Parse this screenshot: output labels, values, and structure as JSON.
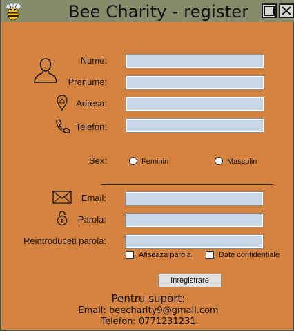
{
  "window": {
    "title": "Bee Charity - register",
    "minimize_label": "minimize",
    "close_label": "close"
  },
  "form": {
    "nume_label": "Nume:",
    "prenume_label": "Prenume:",
    "adresa_label": "Adresa:",
    "telefon_label": "Telefon:",
    "nume_value": "",
    "prenume_value": "",
    "adresa_value": "",
    "telefon_value": "",
    "sex_label": "Sex:",
    "sex_options": [
      "Feminin",
      "Masculin"
    ],
    "email_label": "Email:",
    "parola_label": "Parola:",
    "reintroduceti_label": "Reintroduceti parola:",
    "email_value": "",
    "parola_value": "",
    "reintroduceti_value": "",
    "afiseaza_label": "Afiseaza parola",
    "confidentiale_label": "Date confidentiale",
    "submit_label": "Inregistrare"
  },
  "support": {
    "heading": "Pentru suport:",
    "email": "Email: beecharity9@gmail.com",
    "phone": "Telefon: 0771231231"
  },
  "colors": {
    "background": "#d4823f",
    "titlebar": "#858c6b",
    "field": "#c8d7e6"
  },
  "icons": [
    "bee-icon",
    "user-icon",
    "location-pin-icon",
    "phone-icon",
    "envelope-icon",
    "padlock-icon"
  ]
}
